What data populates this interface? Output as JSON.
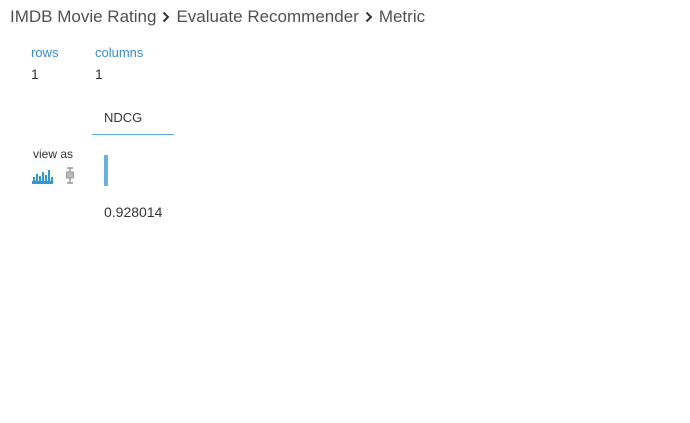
{
  "breadcrumb": {
    "items": [
      {
        "label": "IMDB Movie Rating"
      },
      {
        "label": "Evaluate Recommender"
      },
      {
        "label": "Metric"
      }
    ],
    "separator_icon": "chevron-right-icon"
  },
  "stats": {
    "rows_label": "rows",
    "rows_value": "1",
    "columns_label": "columns",
    "columns_value": "1"
  },
  "table": {
    "columns": [
      {
        "name": "NDCG",
        "values": [
          "0.928014"
        ]
      }
    ]
  },
  "view_as": {
    "label": "view as",
    "options": [
      {
        "icon": "histogram-icon",
        "selected": true
      },
      {
        "icon": "boxplot-icon",
        "selected": false
      }
    ]
  },
  "colors": {
    "accent": "#3a8cc6",
    "bar": "#6ab0d8",
    "histogram_icon": "#2e9ad0",
    "boxplot_icon": "#999999"
  }
}
